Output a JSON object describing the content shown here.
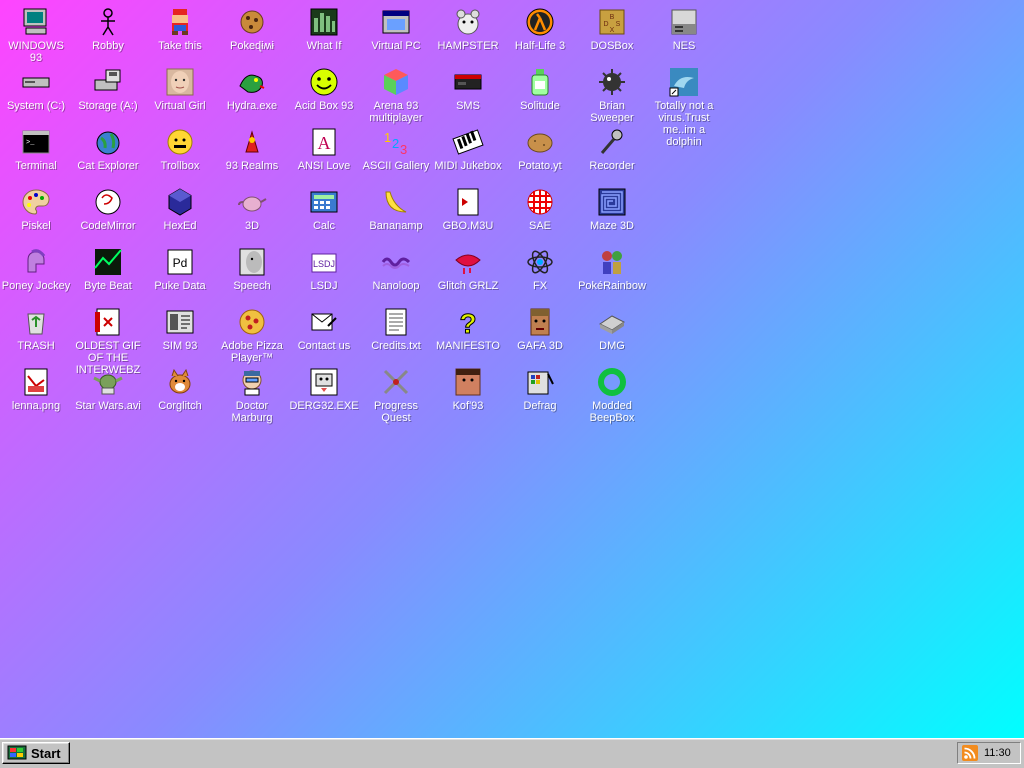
{
  "desktop": {
    "gradient_colors": [
      "#ff44ff",
      "#8a8aff",
      "#00ffff"
    ],
    "icons": [
      {
        "label": "WINDOWS 93",
        "icon": "computer-icon"
      },
      {
        "label": "Robby",
        "icon": "stick-figure-icon"
      },
      {
        "label": "Take this",
        "icon": "mario-icon"
      },
      {
        "label": "Pokeɖɨʍɨ",
        "icon": "cookie-icon"
      },
      {
        "label": "What If",
        "icon": "cityscape-icon"
      },
      {
        "label": "Virtual PC",
        "icon": "window-icon"
      },
      {
        "label": "HAMPSTER",
        "icon": "hamster-icon"
      },
      {
        "label": "Half-Life 3",
        "icon": "lambda-icon"
      },
      {
        "label": "DOSBox",
        "icon": "dosbox-icon"
      },
      {
        "label": "NES",
        "icon": "nes-console-icon"
      },
      {
        "label": "System (C:)",
        "icon": "drive-icon"
      },
      {
        "label": "Storage (A:)",
        "icon": "floppy-drive-icon"
      },
      {
        "label": "Virtual Girl",
        "icon": "face-icon"
      },
      {
        "label": "Hydra.exe",
        "icon": "dragon-icon"
      },
      {
        "label": "Acid Box 93",
        "icon": "smiley-icon"
      },
      {
        "label": "Arena 93 multiplayer",
        "icon": "cube-icon"
      },
      {
        "label": "SMS",
        "icon": "console-icon"
      },
      {
        "label": "Solitude",
        "icon": "bottle-icon"
      },
      {
        "label": "Brian Sweeper",
        "icon": "mine-icon"
      },
      {
        "label": "Totally not a virus.Trust me..im a dolphin",
        "icon": "dolphin-icon"
      },
      {
        "label": "Terminal",
        "icon": "terminal-icon"
      },
      {
        "label": "Cat Explorer",
        "icon": "globe-cat-icon"
      },
      {
        "label": "Trollbox",
        "icon": "chat-icon"
      },
      {
        "label": "93 Realms",
        "icon": "realms-icon"
      },
      {
        "label": "ANSI Love",
        "icon": "letter-a-icon"
      },
      {
        "label": "ASCII Gallery",
        "icon": "numbers-icon"
      },
      {
        "label": "MIDI Jukebox",
        "icon": "piano-icon"
      },
      {
        "label": "Potato.yt",
        "icon": "potato-icon"
      },
      {
        "label": "Recorder",
        "icon": "microphone-icon"
      },
      {
        "label": "Piskel",
        "icon": "palette-icon"
      },
      {
        "label": "CodeMirror",
        "icon": "codemirror-icon"
      },
      {
        "label": "HexEd",
        "icon": "hexagon-icon"
      },
      {
        "label": "3D",
        "icon": "teapot-icon"
      },
      {
        "label": "Calc",
        "icon": "calculator-icon"
      },
      {
        "label": "Bananamp",
        "icon": "banana-icon"
      },
      {
        "label": "GBO.M3U",
        "icon": "playlist-icon"
      },
      {
        "label": "SAE",
        "icon": "ball-icon"
      },
      {
        "label": "Maze 3D",
        "icon": "maze-icon"
      },
      {
        "label": "Poney Jockey",
        "icon": "pony-icon"
      },
      {
        "label": "Byte Beat",
        "icon": "bytebeat-icon"
      },
      {
        "label": "Puke Data",
        "icon": "pd-icon"
      },
      {
        "label": "Speech",
        "icon": "speech-face-icon"
      },
      {
        "label": "LSDJ",
        "icon": "lsdj-icon"
      },
      {
        "label": "Nanoloop",
        "icon": "wave-icon"
      },
      {
        "label": "Glitch GRLZ",
        "icon": "lips-icon"
      },
      {
        "label": "FX",
        "icon": "atom-icon"
      },
      {
        "label": "PokéRainbow",
        "icon": "trainers-icon"
      },
      {
        "label": "TRASH",
        "icon": "recycle-bin-icon"
      },
      {
        "label": "OLDEST GIF OF THE INTERWEBZ",
        "icon": "gif-file-icon"
      },
      {
        "label": "SIM 93",
        "icon": "sim-icon"
      },
      {
        "label": "Adobe Pizza Player™",
        "icon": "pizza-icon"
      },
      {
        "label": "Contact us",
        "icon": "mail-icon"
      },
      {
        "label": "Credits.txt",
        "icon": "text-file-icon"
      },
      {
        "label": "MANIFESTO",
        "icon": "question-mark-icon"
      },
      {
        "label": "GAFA 3D",
        "icon": "doomguy-icon"
      },
      {
        "label": "DMG",
        "icon": "dmg-icon"
      },
      {
        "label": "lenna.png",
        "icon": "image-file-icon"
      },
      {
        "label": "Star Wars.avi",
        "icon": "yoda-icon"
      },
      {
        "label": "Corglitch",
        "icon": "corgi-icon"
      },
      {
        "label": "Doctor Marburg",
        "icon": "doctor-icon"
      },
      {
        "label": "DERG32.EXE",
        "icon": "derg-icon"
      },
      {
        "label": "Progress Quest",
        "icon": "swords-icon"
      },
      {
        "label": "Kof'93",
        "icon": "fighter-icon"
      },
      {
        "label": "Defrag",
        "icon": "defrag-icon"
      },
      {
        "label": "Modded BeepBox",
        "icon": "ring-icon"
      }
    ]
  },
  "taskbar": {
    "start_label": "Start",
    "clock": "11:30",
    "tray_icon": "rss-icon",
    "background": "#c3c3c3"
  }
}
